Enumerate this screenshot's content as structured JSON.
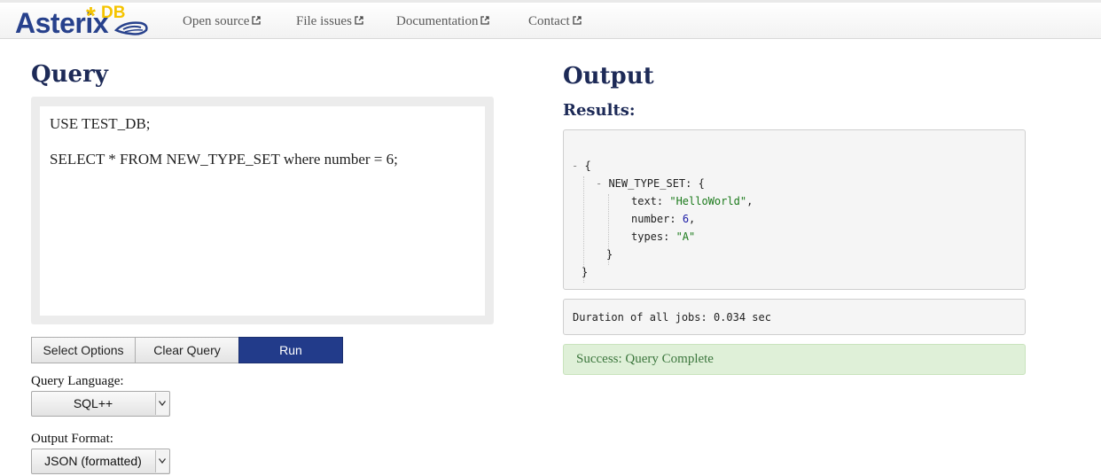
{
  "brand": {
    "name": "Asterix",
    "suffix": "DB",
    "star": "*"
  },
  "nav": [
    {
      "label": "Open source"
    },
    {
      "label": "File issues"
    },
    {
      "label": "Documentation"
    },
    {
      "label": "Contact"
    }
  ],
  "query": {
    "title": "Query",
    "lines": [
      "USE TEST_DB;",
      "",
      "SELECT * FROM NEW_TYPE_SET where number = 6;"
    ]
  },
  "buttons": {
    "select_options": "Select Options",
    "clear_query": "Clear Query",
    "run": "Run"
  },
  "settings": {
    "language_label": "Query Language:",
    "language_value": "SQL++",
    "format_label": "Output Format:",
    "format_value": "JSON (formatted)"
  },
  "output": {
    "title": "Output",
    "results_label": "Results:",
    "result": {
      "open_brace": "{",
      "object_key": "NEW_TYPE_SET",
      "fields": [
        {
          "key": "text",
          "value": "\"HelloWorld\"",
          "kind": "string"
        },
        {
          "key": "number",
          "value": "6",
          "kind": "number"
        },
        {
          "key": "types",
          "value": "\"A\"",
          "kind": "string"
        }
      ],
      "close_brace": "}"
    },
    "duration": "Duration of all jobs: 0.034 sec",
    "status": "Success: Query Complete"
  },
  "colors": {
    "brand_blue": "#27418c",
    "brand_yellow": "#f5c400",
    "run_button": "#223b8a",
    "success_bg": "#dff0d8",
    "success_text": "#3c763d"
  }
}
